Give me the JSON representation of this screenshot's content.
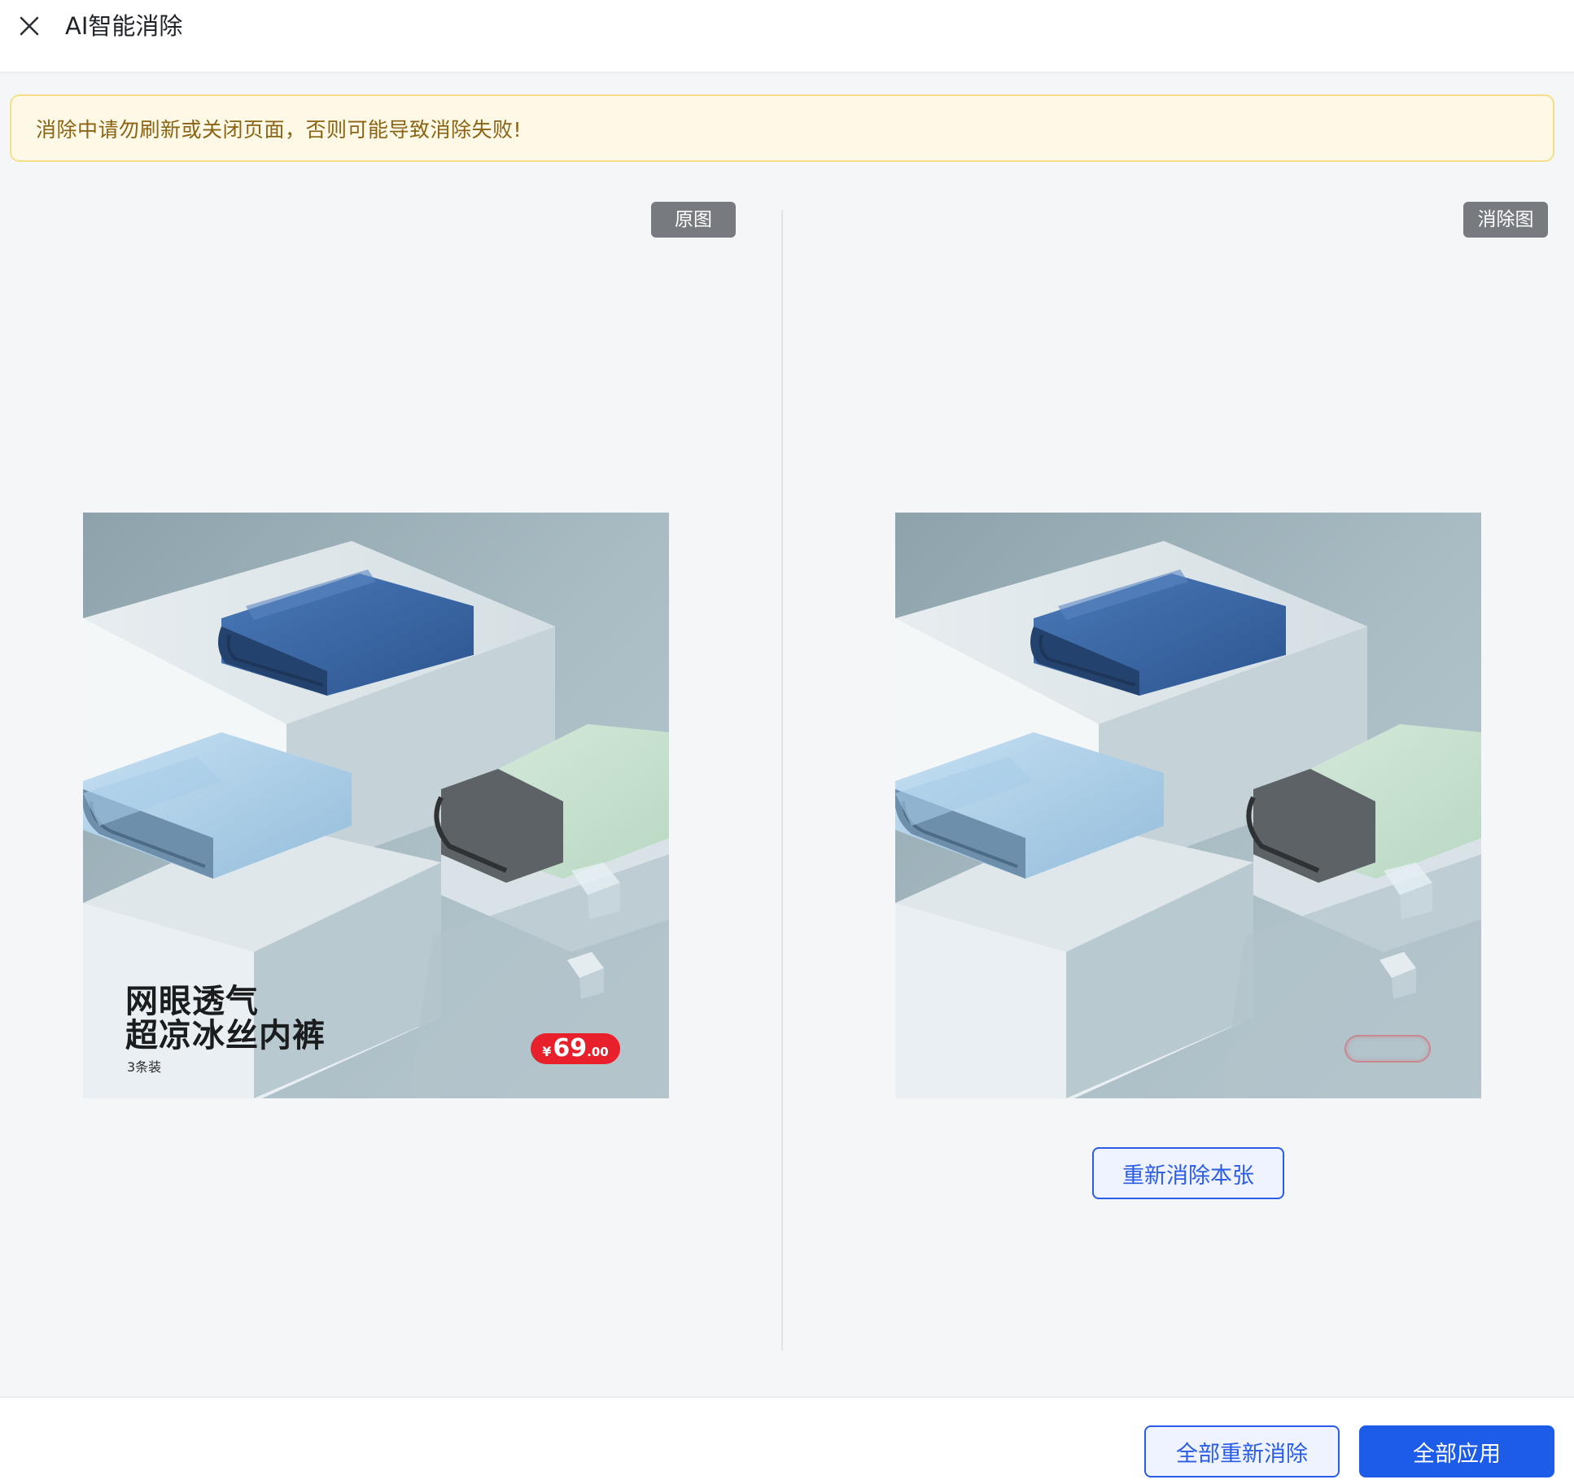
{
  "header": {
    "title": "AI智能消除",
    "close_icon": "close-icon"
  },
  "alert": {
    "text": "消除中请勿刷新或关闭页面，否则可能导致消除失败!"
  },
  "panels": {
    "original_tag": "原图",
    "result_tag": "消除图"
  },
  "original_image": {
    "headline_line1": "网眼透气",
    "headline_line2": "超凉冰丝内裤",
    "subtitle": "3条装",
    "price_symbol": "¥",
    "price_main": "69",
    "price_decimal": ".00",
    "price_color": "#e8202c"
  },
  "actions": {
    "redo_this": "重新消除本张",
    "redo_all": "全部重新消除",
    "apply_all": "全部应用"
  },
  "colors": {
    "primary": "#1d5ce8",
    "warning_bg": "#fef9e6",
    "warning_text": "#8a6414",
    "tag_bg": "#777a7f"
  }
}
